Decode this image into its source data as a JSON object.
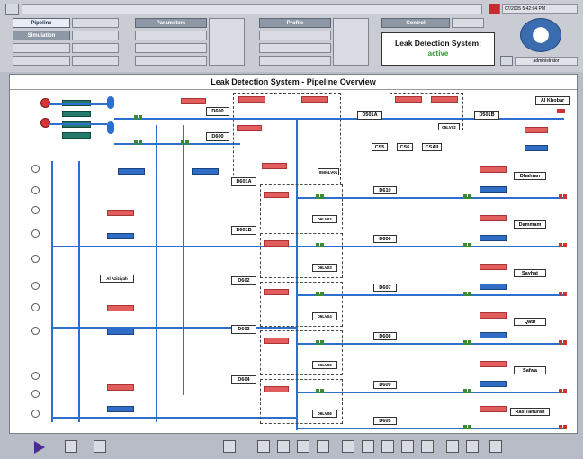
{
  "topbar": {
    "datetime": "07/2005 5:42:04 PM",
    "user": "administrator",
    "tabs": {
      "pipeline": "Pipeline",
      "simulation": "Simulation",
      "parameters": "Parameters",
      "profile": "Profile",
      "control": "Control"
    },
    "status_title": "Leak Detection System:",
    "status_value": "active"
  },
  "main": {
    "title": "Leak Detection System - Pipeline Overview",
    "cities": [
      "Al Khobar",
      "Dhahran",
      "Dammam",
      "Sayhat",
      "Qatif",
      "Safwa",
      "Ras Tanurah"
    ],
    "district": "Al Aziziyah",
    "towers": [
      "D600",
      "D600",
      "D601A",
      "D601B",
      "D602",
      "D603",
      "D604"
    ],
    "sections": [
      "D501A",
      "D501B",
      "D610",
      "D606",
      "D607",
      "D608",
      "D609",
      "D605"
    ],
    "cs": [
      "CS5",
      "CS6",
      "CSAll"
    ],
    "lv": [
      "05LV02",
      "0506LV01",
      "06LV02",
      "06LV03",
      "06LV04",
      "06LV05",
      "06LV06"
    ],
    "label_small": "991B"
  },
  "colors": {
    "pipe": "#2c6fcf",
    "alarm": "#e25d5d",
    "flow": "#2f6ec4",
    "active": "#2a9a2a"
  }
}
